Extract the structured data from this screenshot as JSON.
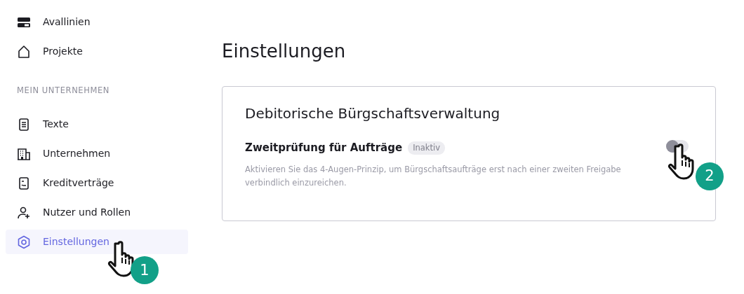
{
  "sidebar": {
    "items": [
      {
        "label": "Avallinien",
        "kind": "lines",
        "selected": false
      },
      {
        "label": "Projekte",
        "kind": "house",
        "selected": false
      }
    ],
    "section": {
      "title": "MEIN UNTERNEHMEN",
      "items": [
        {
          "label": "Texte",
          "kind": "document",
          "selected": false
        },
        {
          "label": "Unternehmen",
          "kind": "building",
          "selected": false
        },
        {
          "label": "Kreditverträge",
          "kind": "contract",
          "selected": false
        },
        {
          "label": "Nutzer und Rollen",
          "kind": "user",
          "selected": false
        },
        {
          "label": "Einstellungen",
          "kind": "settings",
          "selected": true,
          "callout": "1"
        }
      ]
    }
  },
  "page_title": "Einstellungen",
  "card": {
    "title": "Debitorische Bürgschaftsverwaltung",
    "settings": [
      {
        "label": "Zweitprüfung für Aufträge",
        "status": "Inaktiv",
        "description": "Aktivieren Sie das 4-Augen-Prinzip, um Bürgschaftsaufträge erst nach einer zweiten Freigabe verbindlich einzureichen.",
        "on": false,
        "callout": "2"
      }
    ]
  }
}
